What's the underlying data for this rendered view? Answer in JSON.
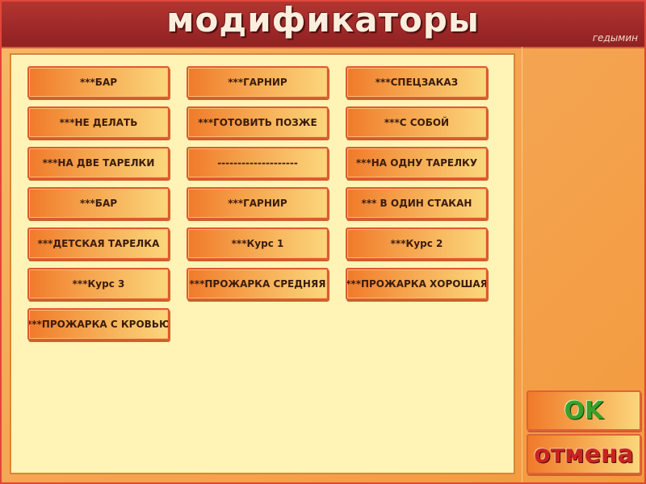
{
  "header": {
    "title": "модификаторы",
    "user": "гедымин"
  },
  "modifiers": [
    "***БАР",
    "***ГАРНИР",
    "***СПЕЦЗАКАЗ",
    "***НЕ ДЕЛАТЬ",
    "***ГОТОВИТЬ ПОЗЖЕ",
    "***С СОБОЙ",
    "***НА ДВЕ ТАРЕЛКИ",
    "--------------------",
    "***НА ОДНУ ТАРЕЛКУ",
    "***БАР",
    "***ГАРНИР",
    "*** В ОДИН СТАКАН",
    "***ДЕТСКАЯ ТАРЕЛКА",
    "***Курс 1",
    "***Курс 2",
    "***Курс 3",
    "***ПРОЖАРКА СРЕДНЯЯ",
    "***ПРОЖАРКА ХОРОШАЯ",
    "***ПРОЖАРКА С КРОВЬЮ"
  ],
  "actions": {
    "ok_label": "OK",
    "cancel_label": "отмена"
  },
  "colors": {
    "header": "#9e2828",
    "panel": "#fff3b5",
    "ok_text": "#38a12c",
    "cancel_text": "#c8241f"
  }
}
